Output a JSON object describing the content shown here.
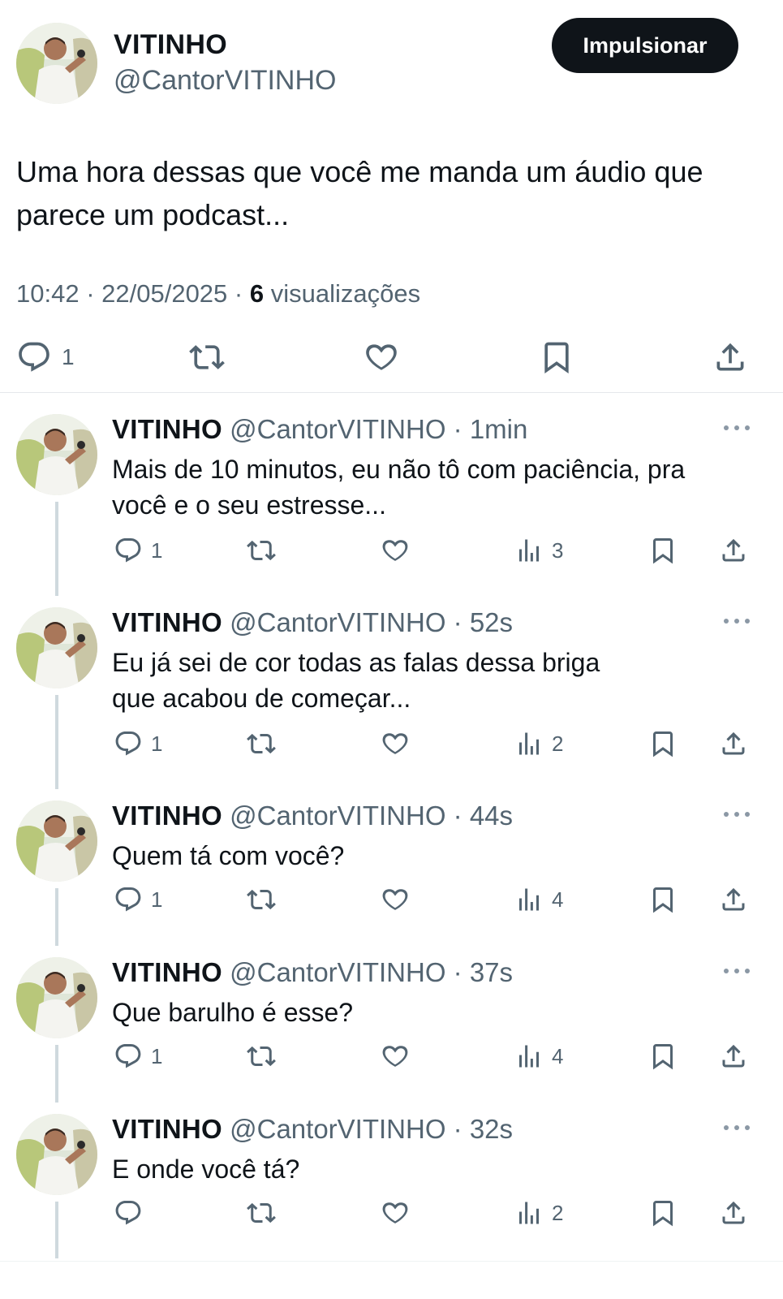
{
  "main": {
    "name": "VITINHO",
    "handle": "@CantorVITINHO",
    "boost_label": "Impulsionar",
    "text_line1": "Uma hora dessas que você me manda um áudio que",
    "text_line2": "parece um podcast...",
    "time": "10:42",
    "date": "22/05/2025",
    "views_count": "6",
    "views_label": "visualizações",
    "reply_count": "1"
  },
  "separator": "·",
  "replies": [
    {
      "name": "VITINHO",
      "handle": "@CantorVITINHO",
      "time": "1min",
      "text_line1": "Mais de 10 minutos, eu não tô com paciência, pra",
      "text_line2": "você e o seu estresse...",
      "replies": "1",
      "views": "3"
    },
    {
      "name": "VITINHO",
      "handle": "@CantorVITINHO",
      "time": "52s",
      "text_line1": "Eu já sei de cor todas as falas dessa briga",
      "text_line2": "que acabou de começar...",
      "replies": "1",
      "views": "2"
    },
    {
      "name": "VITINHO",
      "handle": "@CantorVITINHO",
      "time": "44s",
      "text_line1": "Quem tá com você?",
      "text_line2": "",
      "replies": "1",
      "views": "4"
    },
    {
      "name": "VITINHO",
      "handle": "@CantorVITINHO",
      "time": "37s",
      "text_line1": "Que barulho é esse?",
      "text_line2": "",
      "replies": "1",
      "views": "4"
    },
    {
      "name": "VITINHO",
      "handle": "@CantorVITINHO",
      "time": "32s",
      "text_line1": "E onde você tá?",
      "text_line2": "",
      "replies": "",
      "views": "2"
    }
  ],
  "icons": {
    "reply": "reply-icon",
    "retweet": "retweet-icon",
    "like": "heart-icon",
    "views": "analytics-icon",
    "bookmark": "bookmark-icon",
    "share": "share-icon",
    "more": "more-icon"
  },
  "colors": {
    "text": "#0f1419",
    "muted": "#536471",
    "button": "#0f1419",
    "thread_line": "#cfd9de"
  }
}
